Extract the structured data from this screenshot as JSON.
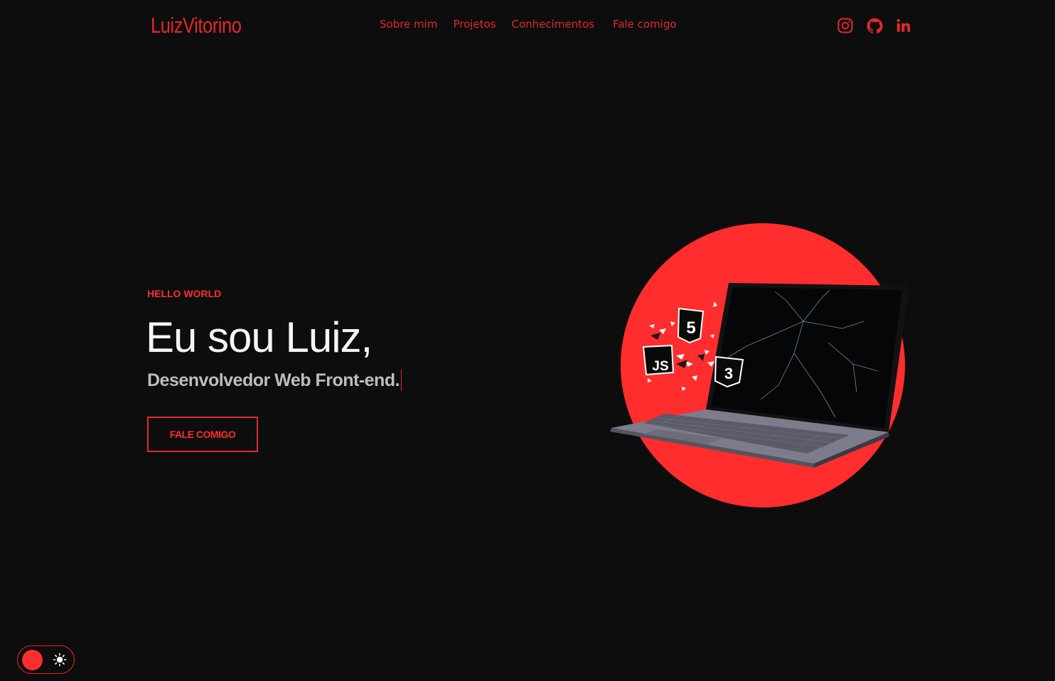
{
  "header": {
    "logo": "LuizVitorino",
    "nav": [
      {
        "label": "Sobre mim"
      },
      {
        "label": "Projetos"
      },
      {
        "label": "Conhecimentos"
      },
      {
        "label": "Fale comigo"
      }
    ],
    "socials": [
      "instagram-icon",
      "github-icon",
      "linkedin-icon"
    ]
  },
  "hero": {
    "eyebrow": "HELLO WORLD",
    "headline": "Eu sou Luiz,",
    "subline": "Desenvolvedor Web Front-end.",
    "cta_label": "FALE COMIGO"
  },
  "illustration": {
    "badges": [
      {
        "label": "5",
        "icon": "html5-icon"
      },
      {
        "label": "JS",
        "icon": "javascript-icon"
      },
      {
        "label": "3",
        "icon": "css3-icon"
      }
    ]
  },
  "theme_toggle": {
    "icon": "sun-icon"
  },
  "colors": {
    "accent": "#e3282a",
    "accent_bright": "#ff2d2d",
    "background": "#0d0d0d",
    "headline": "#f5f5f5",
    "subline": "#bdbdbd"
  }
}
